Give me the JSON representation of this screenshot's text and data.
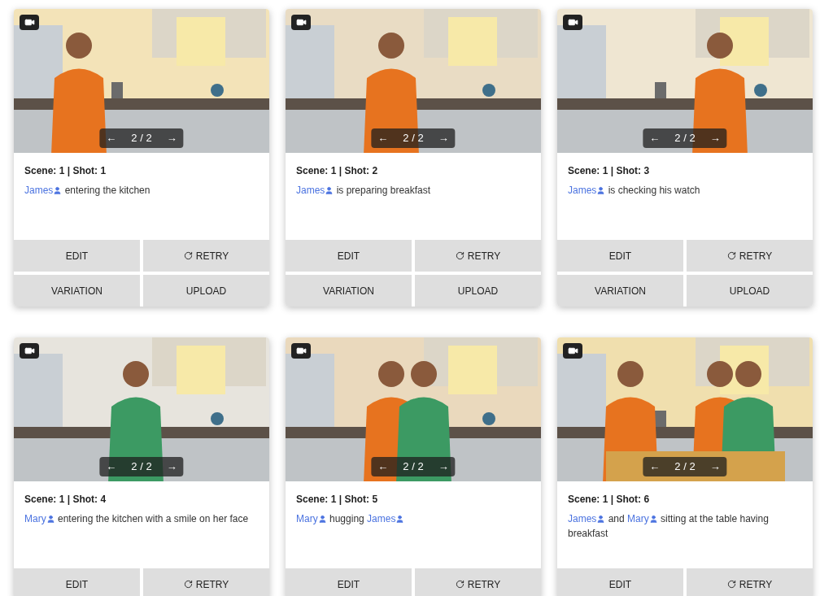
{
  "cards": [
    {
      "pager": {
        "prev": "←",
        "count": "2 / 2",
        "next": "→"
      },
      "title": "Scene: 1 | Shot: 1",
      "description": [
        {
          "kind": "character",
          "text": "James"
        },
        {
          "kind": "text",
          "text": "entering the kitchen"
        }
      ],
      "buttons": [
        {
          "kind": "edit",
          "label": "EDIT"
        },
        {
          "kind": "retry",
          "label": "RETRY"
        },
        {
          "kind": "variation",
          "label": "VARIATION"
        },
        {
          "kind": "upload",
          "label": "UPLOAD"
        }
      ]
    },
    {
      "pager": {
        "prev": "←",
        "count": "2 / 2",
        "next": "→"
      },
      "title": "Scene: 1 | Shot: 2",
      "description": [
        {
          "kind": "character",
          "text": "James"
        },
        {
          "kind": "text",
          "text": "is preparing breakfast"
        }
      ],
      "buttons": [
        {
          "kind": "edit",
          "label": "EDIT"
        },
        {
          "kind": "retry",
          "label": "RETRY"
        },
        {
          "kind": "variation",
          "label": "VARIATION"
        },
        {
          "kind": "upload",
          "label": "UPLOAD"
        }
      ]
    },
    {
      "pager": {
        "prev": "←",
        "count": "2 / 2",
        "next": "→"
      },
      "title": "Scene: 1 | Shot: 3",
      "description": [
        {
          "kind": "character",
          "text": "James"
        },
        {
          "kind": "text",
          "text": "is checking his watch"
        }
      ],
      "buttons": [
        {
          "kind": "edit",
          "label": "EDIT"
        },
        {
          "kind": "retry",
          "label": "RETRY"
        },
        {
          "kind": "variation",
          "label": "VARIATION"
        },
        {
          "kind": "upload",
          "label": "UPLOAD"
        }
      ]
    },
    {
      "pager": {
        "prev": "←",
        "count": "2 / 2",
        "next": "→"
      },
      "title": "Scene: 1 | Shot: 4",
      "description": [
        {
          "kind": "character",
          "text": "Mary"
        },
        {
          "kind": "text",
          "text": "entering the kitchen with a smile on her face"
        }
      ],
      "buttons": [
        {
          "kind": "edit",
          "label": "EDIT"
        },
        {
          "kind": "retry",
          "label": "RETRY"
        }
      ]
    },
    {
      "pager": {
        "prev": "←",
        "count": "2 / 2",
        "next": "→"
      },
      "title": "Scene: 1 | Shot: 5",
      "description": [
        {
          "kind": "character",
          "text": "Mary"
        },
        {
          "kind": "text",
          "text": "hugging"
        },
        {
          "kind": "character",
          "text": "James"
        }
      ],
      "buttons": [
        {
          "kind": "edit",
          "label": "EDIT"
        },
        {
          "kind": "retry",
          "label": "RETRY"
        }
      ]
    },
    {
      "pager": {
        "prev": "←",
        "count": "2 / 2",
        "next": "→"
      },
      "title": "Scene: 1 | Shot: 6",
      "description": [
        {
          "kind": "character",
          "text": "James"
        },
        {
          "kind": "text",
          "text": "and"
        },
        {
          "kind": "character",
          "text": "Mary"
        },
        {
          "kind": "text",
          "text": "sitting at the table having breakfast"
        }
      ],
      "buttons": [
        {
          "kind": "edit",
          "label": "EDIT"
        },
        {
          "kind": "retry",
          "label": "RETRY"
        }
      ]
    }
  ]
}
